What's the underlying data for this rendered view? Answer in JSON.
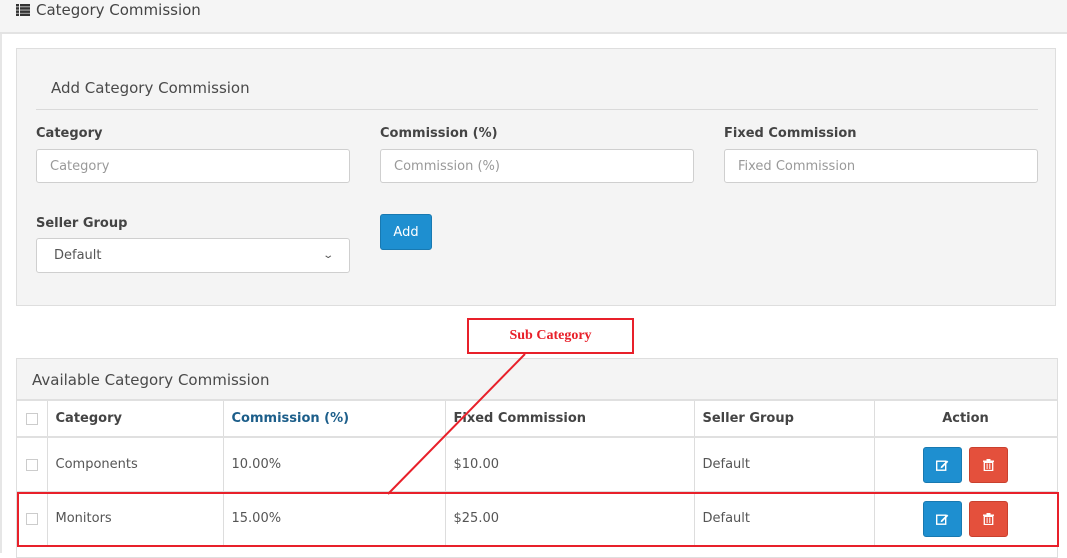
{
  "page": {
    "title": "Category Commission",
    "title_icon": "list-icon"
  },
  "add_form": {
    "heading": "Add Category Commission",
    "category": {
      "label": "Category",
      "placeholder": "Category",
      "value": ""
    },
    "commission_percent": {
      "label": "Commission (%)",
      "placeholder": "Commission (%)",
      "value": ""
    },
    "fixed_commission": {
      "label": "Fixed Commission",
      "placeholder": "Fixed Commission",
      "value": ""
    },
    "seller_group": {
      "label": "Seller Group",
      "selected": "Default"
    },
    "add_label": "Add"
  },
  "table": {
    "heading": "Available Category Commission",
    "columns": [
      "Category",
      "Commission (%)",
      "Fixed Commission",
      "Seller Group",
      "Action"
    ],
    "sorted_column": "Commission (%)",
    "rows": [
      {
        "category": "Components",
        "commission": "10.00%",
        "fixed": "$10.00",
        "seller_group": "Default"
      },
      {
        "category": "Monitors",
        "commission": "15.00%",
        "fixed": "$25.00",
        "seller_group": "Default"
      }
    ],
    "row_actions": {
      "edit_icon": "edit-icon",
      "delete_icon": "trash-icon"
    }
  },
  "annotation": {
    "label": "Sub Category",
    "color": "#e8202a",
    "target_row": "Monitors"
  },
  "colors": {
    "primary": "#1e8fd0",
    "danger": "#e4503c",
    "sorted_header": "#1c5e8a"
  }
}
